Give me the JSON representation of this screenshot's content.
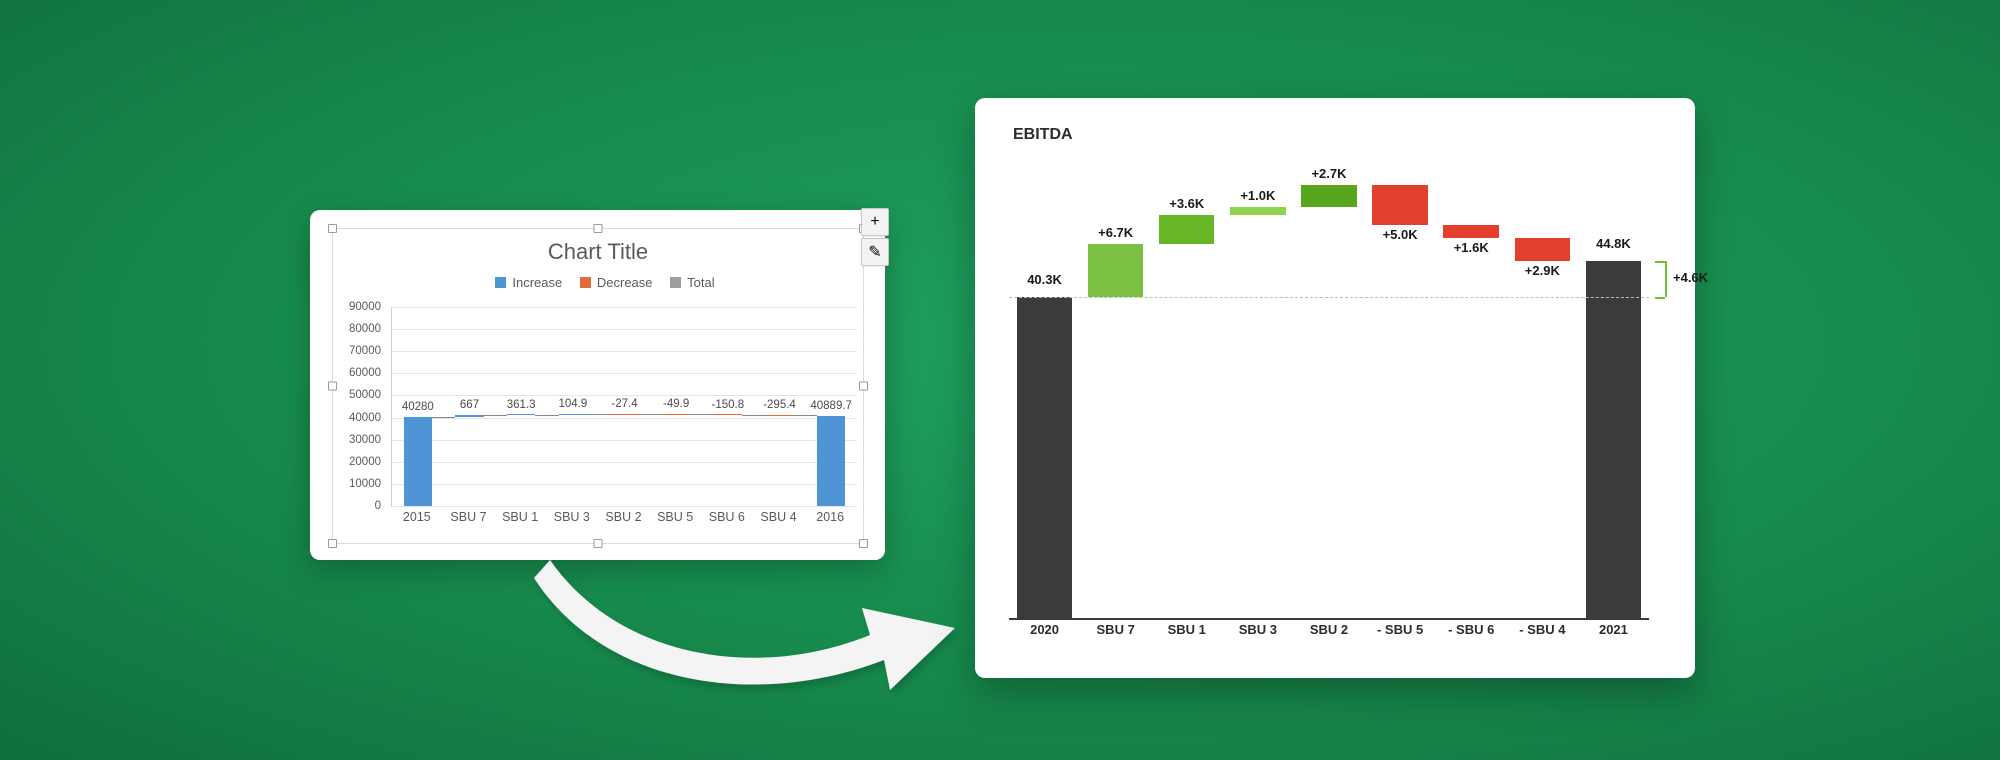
{
  "colors": {
    "excel_increase": "#4f94d4",
    "excel_decrease": "#e06c3c",
    "excel_total": "#9e9e9e",
    "right_total": "#3b3b3b",
    "right_increase": "#6fbf3a",
    "right_increase_dark": "#4aa21e",
    "right_decrease": "#e43f2e"
  },
  "left": {
    "title": "Chart Title",
    "legend": {
      "increase": "Increase",
      "decrease": "Decrease",
      "total": "Total"
    },
    "side_buttons": {
      "plus": "+",
      "brush": "✎"
    }
  },
  "right": {
    "title": "EBITDA",
    "diff_label": "+4.6K"
  },
  "chart_data": [
    {
      "id": "left",
      "type": "bar",
      "subtype": "waterfall",
      "title": "Chart Title",
      "ylim": [
        0,
        90000
      ],
      "yticks": [
        0,
        10000,
        20000,
        30000,
        40000,
        50000,
        60000,
        70000,
        80000,
        90000
      ],
      "categories": [
        "2015",
        "SBU 7",
        "SBU 1",
        "SBU 3",
        "SBU 2",
        "SBU 5",
        "SBU 6",
        "SBU 4",
        "2016"
      ],
      "values": [
        40280,
        667,
        361.3,
        104.9,
        -27.4,
        -49.9,
        -150.8,
        -295.4,
        40889.7
      ],
      "value_labels": [
        "40280",
        "667",
        "361.3",
        "104.9",
        "-27.4",
        "-49.9",
        "-150.8",
        "-295.4",
        "40889.7"
      ],
      "kind": [
        "total",
        "delta",
        "delta",
        "delta",
        "delta",
        "delta",
        "delta",
        "delta",
        "total"
      ],
      "legend": [
        "Increase",
        "Decrease",
        "Total"
      ]
    },
    {
      "id": "right",
      "type": "bar",
      "subtype": "waterfall",
      "title": "EBITDA",
      "categories": [
        "2020",
        "SBU 7",
        "SBU 1",
        "SBU 3",
        "SBU 2",
        "- SBU 5",
        "- SBU 6",
        "- SBU 4",
        "2021"
      ],
      "value_labels": [
        "40.3K",
        "+6.7K",
        "+3.6K",
        "+1.0K",
        "+2.7K",
        "+5.0K",
        "+1.6K",
        "+2.9K",
        "44.8K"
      ],
      "values": [
        40300,
        6700,
        3600,
        1000,
        2700,
        -5000,
        -1600,
        -2900,
        44800
      ],
      "kind": [
        "total",
        "increase",
        "increase",
        "increase",
        "increase",
        "decrease",
        "decrease",
        "decrease",
        "total"
      ],
      "difference": {
        "label": "+4.6K",
        "value": 4600,
        "from": "2020",
        "to": "2021"
      }
    }
  ]
}
